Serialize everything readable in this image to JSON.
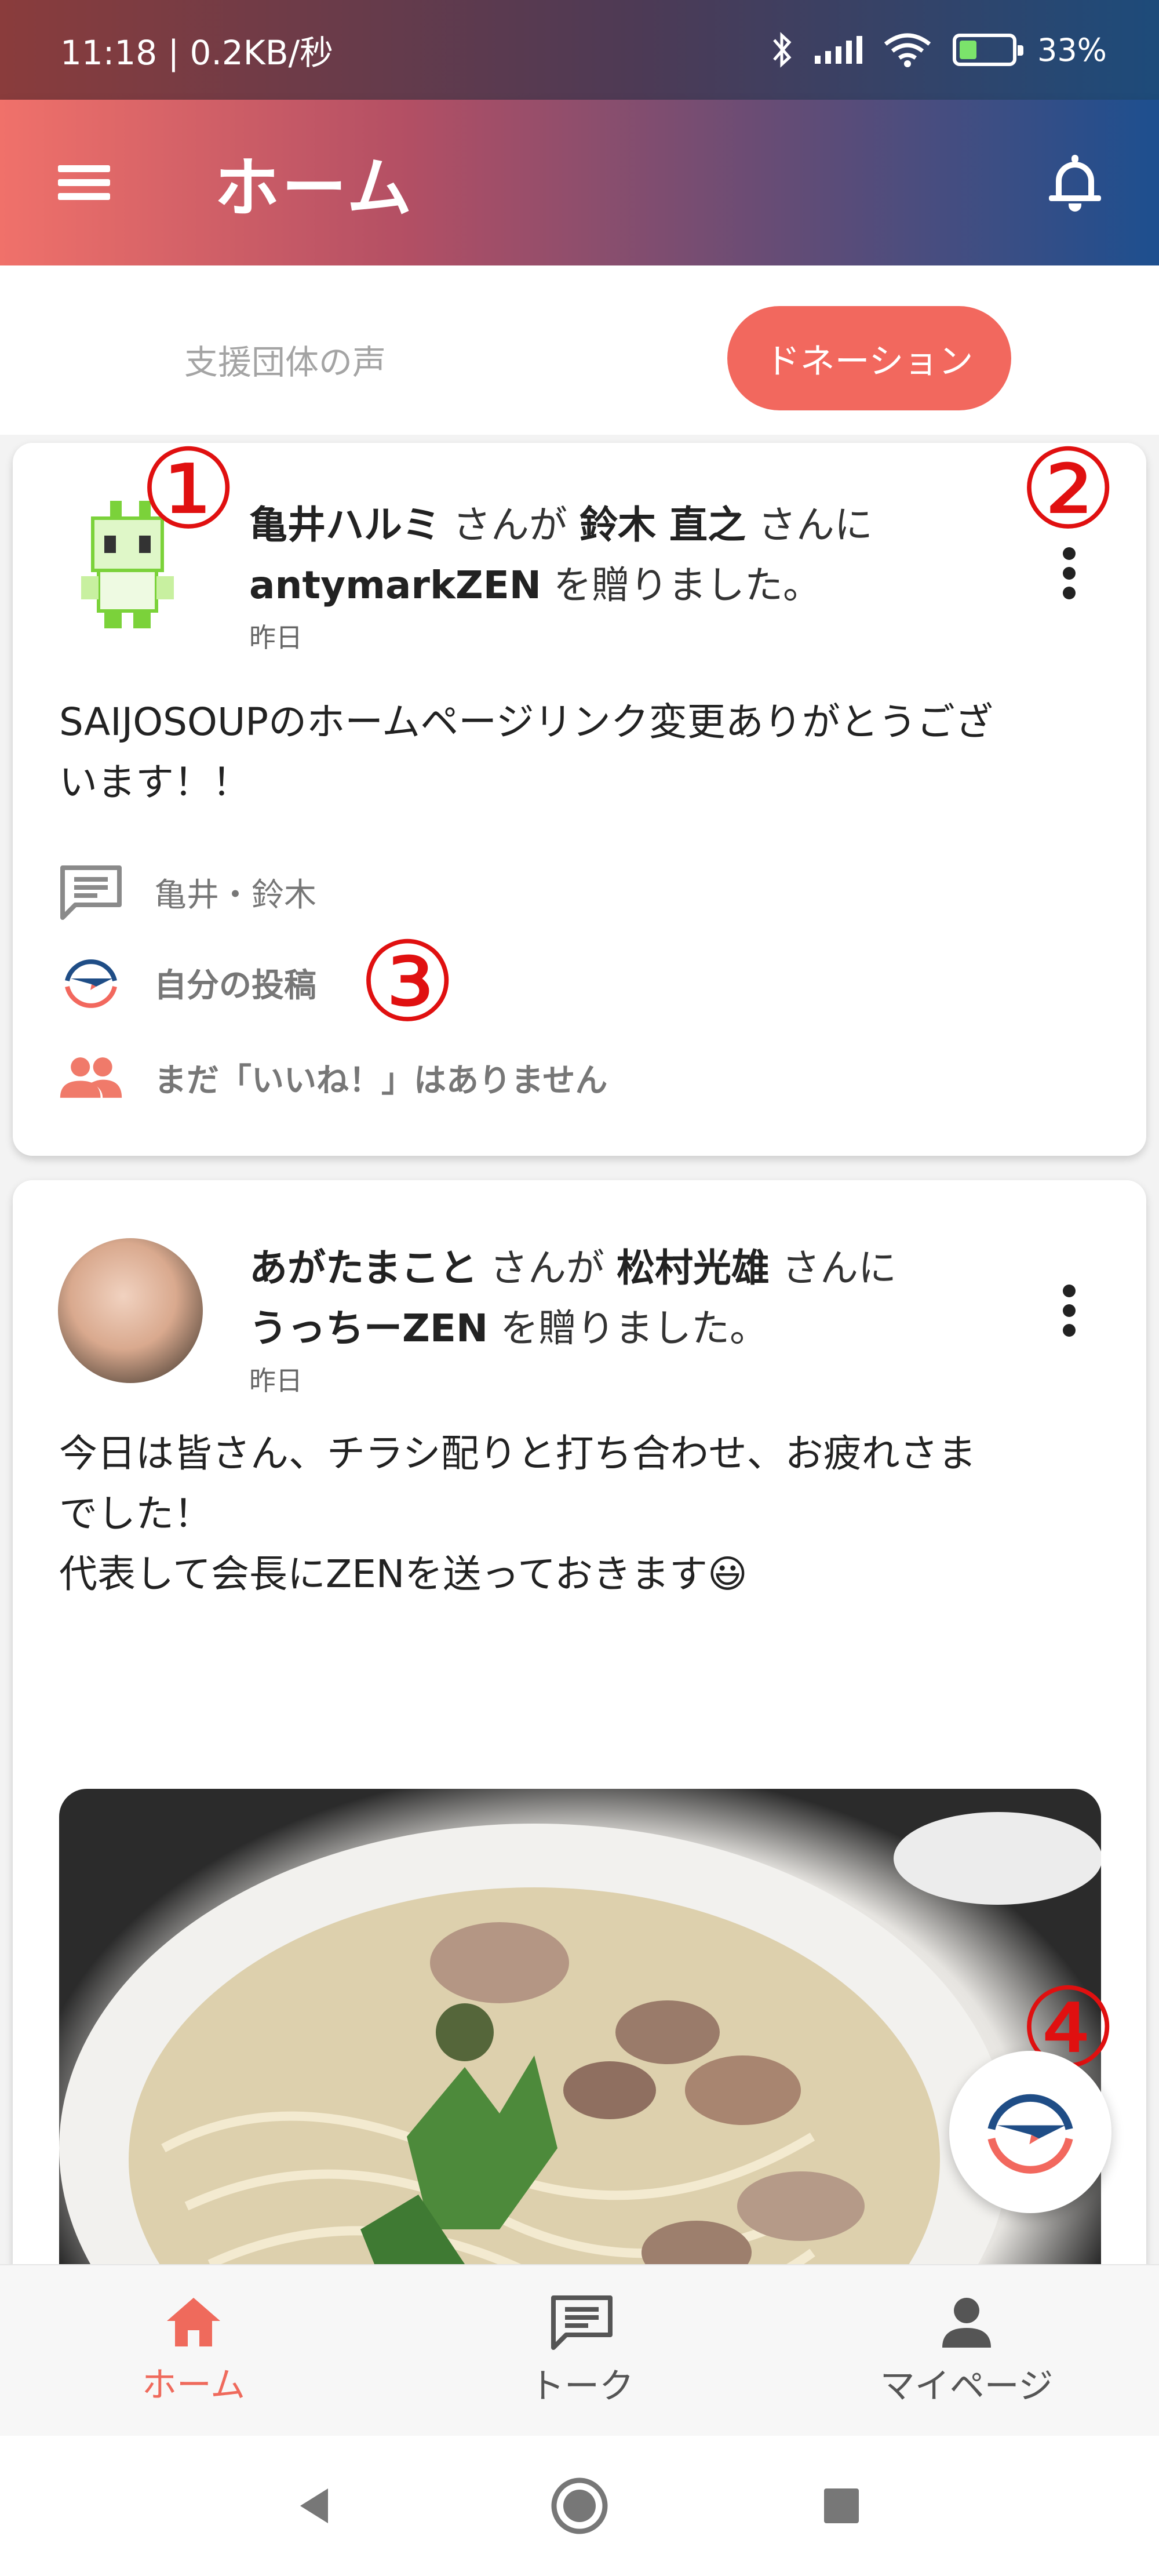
{
  "status_bar": {
    "time": "11:18 | 0.2KB/秒",
    "battery": "33%"
  },
  "app_bar": {
    "title": "ホーム"
  },
  "tabs": {
    "voices": "支援団体の声",
    "donation": "ドネーション"
  },
  "posts": [
    {
      "sender": "亀井ハルミ",
      "san1": " さんが ",
      "receiver": "鈴木 直之",
      "san2": " さんに",
      "gift": "antymarkZEN",
      "gift_suffix": " を贈りました。",
      "date": "昨日",
      "message_line1": "SAIJOSOUPのホームページリンク変更ありがとうござ",
      "message_line2": "います！！",
      "participants": "亀井・鈴木",
      "own_post": "自分の投稿",
      "likes": "まだ「いいね！」はありません"
    },
    {
      "sender": "あがたまこと",
      "san1": " さんが ",
      "receiver": "松村光雄",
      "san2": " さんに",
      "gift": "うっちーZEN",
      "gift_suffix": " を贈りました。",
      "date": "昨日",
      "message_line1": "今日は皆さん、チラシ配りと打ち合わせ、お疲れさま",
      "message_line2": "でした！",
      "message_line3": "代表して会長にZENを送っておきます😃"
    }
  ],
  "annotations": [
    "①",
    "②",
    "③",
    "④"
  ],
  "bottom_nav": {
    "home": "ホーム",
    "talk": "トーク",
    "mypage": "マイページ"
  },
  "colors": {
    "accent": "#f2685e",
    "logo_blue": "#1f4d86",
    "annotation_red": "#e01010"
  },
  "icons": [
    "menu-icon",
    "bell-icon",
    "more-vert-icon",
    "chat-icon",
    "app-logo-icon",
    "people-icon",
    "home-icon",
    "person-icon",
    "back-icon",
    "circle-home-icon",
    "square-recent-icon"
  ]
}
